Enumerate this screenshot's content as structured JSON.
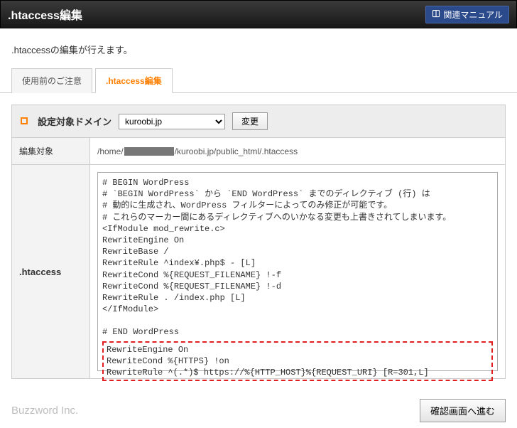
{
  "header": {
    "title": ".htaccess編集",
    "manual_label": "関連マニュアル"
  },
  "intro": ".htaccessの編集が行えます。",
  "tabs": {
    "precaution": "使用前のご注意",
    "edit": ".htaccess編集"
  },
  "domain": {
    "label": "設定対象ドメイン",
    "selected": "kuroobi.jp",
    "change_btn": "変更"
  },
  "target": {
    "label": "編集対象",
    "path_prefix": "/home/",
    "path_suffix": "/kuroobi.jp/public_html/.htaccess"
  },
  "editor": {
    "label": ".htaccess",
    "code_main": "# BEGIN WordPress\n# `BEGIN WordPress` から `END WordPress` までのディレクティブ (行) は\n# 動的に生成され、WordPress フィルターによってのみ修正が可能です。\n# これらのマーカー間にあるディレクティブへのいかなる変更も上書きされてしまいます。\n<IfModule mod_rewrite.c>\nRewriteEngine On\nRewriteBase /\nRewriteRule ^index¥.php$ - [L]\nRewriteCond %{REQUEST_FILENAME} !-f\nRewriteCond %{REQUEST_FILENAME} !-d\nRewriteRule . /index.php [L]\n</IfModule>\n\n# END WordPress\n",
    "code_highlight": "RewriteEngine On\nRewriteCond %{HTTPS} !on\nRewriteRule ^(.*)$ https://%{HTTP_HOST}%{REQUEST_URI} [R=301,L]"
  },
  "footer": {
    "brand": "Buzzword Inc.",
    "confirm_btn": "確認画面へ進む"
  }
}
